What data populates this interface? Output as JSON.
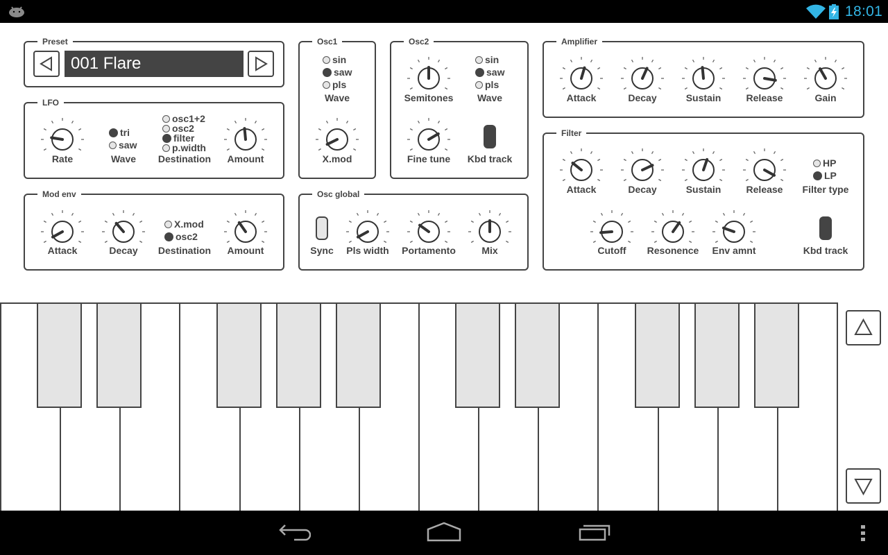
{
  "status_bar": {
    "time": "18:01",
    "icons": [
      "android-debug-icon",
      "wifi-icon",
      "battery-charging-icon"
    ],
    "accent_color": "#33b5e5"
  },
  "preset": {
    "title": "Preset",
    "name": "001 Flare",
    "prev_icon": "triangle-left-icon",
    "next_icon": "triangle-right-icon"
  },
  "lfo": {
    "title": "LFO",
    "rate": {
      "label": "Rate",
      "value": 0.2
    },
    "wave": {
      "label": "Wave",
      "options": [
        "tri",
        "saw"
      ],
      "selected": "tri"
    },
    "destination": {
      "label": "Destination",
      "options": [
        "osc1+2",
        "osc2",
        "filter",
        "p.width"
      ],
      "selected": "filter"
    },
    "amount": {
      "label": "Amount",
      "value": 0.48
    }
  },
  "mod_env": {
    "title": "Mod env",
    "attack": {
      "label": "Attack",
      "value": 0.06
    },
    "decay": {
      "label": "Decay",
      "value": 0.35
    },
    "destination": {
      "label": "Destination",
      "options": [
        "X.mod",
        "osc2"
      ],
      "selected": "osc2"
    },
    "amount": {
      "label": "Amount",
      "value": 0.37
    }
  },
  "osc1": {
    "title": "Osc1",
    "wave": {
      "label": "Wave",
      "options": [
        "sin",
        "saw",
        "pls"
      ],
      "selected": "saw"
    },
    "xmod": {
      "label": "X.mod",
      "value": 0.07
    }
  },
  "osc2": {
    "title": "Osc2",
    "semitones": {
      "label": "Semitones",
      "value": 0.5
    },
    "wave": {
      "label": "Wave",
      "options": [
        "sin",
        "saw",
        "pls"
      ],
      "selected": "saw"
    },
    "fine_tune": {
      "label": "Fine tune",
      "value": 0.72
    },
    "kbd_track": {
      "label": "Kbd track",
      "on": true
    }
  },
  "osc_global": {
    "title": "Osc global",
    "sync": {
      "label": "Sync",
      "on": false
    },
    "pls_width": {
      "label": "Pls width",
      "value": 0.06
    },
    "portamento": {
      "label": "Portamento",
      "value": 0.3
    },
    "mix": {
      "label": "Mix",
      "value": 0.5
    }
  },
  "amplifier": {
    "title": "Amplifier",
    "attack": {
      "label": "Attack",
      "value": 0.56
    },
    "decay": {
      "label": "Decay",
      "value": 0.59
    },
    "sustain": {
      "label": "Sustain",
      "value": 0.48
    },
    "release": {
      "label": "Release",
      "value": 0.87
    },
    "gain": {
      "label": "Gain",
      "value": 0.39
    }
  },
  "filter": {
    "title": "Filter",
    "attack": {
      "label": "Attack",
      "value": 0.31
    },
    "decay": {
      "label": "Decay",
      "value": 0.74
    },
    "sustain": {
      "label": "Sustain",
      "value": 0.57
    },
    "release": {
      "label": "Release",
      "value": 0.94
    },
    "filter_type": {
      "label": "Filter type",
      "options": [
        "HP",
        "LP"
      ],
      "selected": "LP"
    },
    "cutoff": {
      "label": "Cutoff",
      "value": 0.15
    },
    "resonance": {
      "label": "Resonence",
      "value": 0.63
    },
    "env_amount": {
      "label": "Env amnt",
      "value": 0.24
    },
    "kbd_track": {
      "label": "Kbd track",
      "on": true
    }
  },
  "keyboard": {
    "white_keys": 14,
    "black_keys_after_white": [
      0,
      1,
      3,
      4,
      5,
      7,
      8,
      10,
      11,
      12
    ],
    "octave_up_icon": "triangle-up-icon",
    "octave_down_icon": "triangle-down-icon"
  },
  "nav_bar": {
    "buttons": [
      "back-icon",
      "home-icon",
      "recents-icon",
      "overflow-menu-icon"
    ]
  }
}
